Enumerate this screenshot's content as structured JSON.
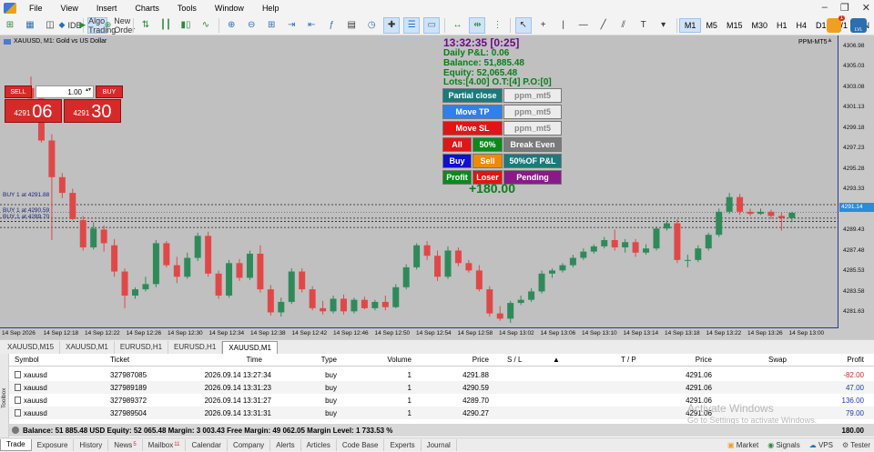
{
  "menu": {
    "items": [
      "File",
      "View",
      "Insert",
      "Charts",
      "Tools",
      "Window",
      "Help"
    ]
  },
  "toolbar": {
    "ide_label": "IDE",
    "algo_label": "Algo Trading",
    "new_order_label": "New Order",
    "timeframes": [
      "M1",
      "M5",
      "M15",
      "M30",
      "H1",
      "H4",
      "D1",
      "W1",
      "MN"
    ],
    "active_timeframe": "M1",
    "notification_count": "1",
    "news_badge": "LVL"
  },
  "chart": {
    "title": "XAUUSD, M1:  Gold vs US Dollar",
    "ea_name": "PPM-MT5",
    "current_price": "4291.14",
    "y_labels": [
      "4306.98",
      "4305.03",
      "4303.08",
      "4301.13",
      "4299.18",
      "4297.23",
      "4295.28",
      "4293.33",
      "4289.43",
      "4287.48",
      "4285.53",
      "4283.58",
      "4281.63"
    ],
    "x_labels": [
      "14 Sep 2026",
      "14 Sep 12:18",
      "14 Sep 12:22",
      "14 Sep 12:26",
      "14 Sep 12:30",
      "14 Sep 12:34",
      "14 Sep 12:38",
      "14 Sep 12:42",
      "14 Sep 12:46",
      "14 Sep 12:50",
      "14 Sep 12:54",
      "14 Sep 12:58",
      "14 Sep 13:02",
      "14 Sep 13:06",
      "14 Sep 13:10",
      "14 Sep 13:14",
      "14 Sep 13:18",
      "14 Sep 13:22",
      "14 Sep 13:26",
      "14 Sep 13:00"
    ],
    "order_labels": [
      "BUY 1 at 4291.88",
      "BUY 1 at 4290.59",
      "BUY 1 at 4289.70"
    ],
    "one_click": {
      "sell_label": "SELL",
      "buy_label": "BUY",
      "lot": "1.00",
      "sell_price_small": "4291",
      "sell_price_big": "06",
      "buy_price_small": "4291",
      "buy_price_big": "30"
    }
  },
  "panel": {
    "time": "13:32:35 [0:25]",
    "daily_pl": "Daily P&L: 0.06",
    "balance": "Balance: 51,885.48",
    "equity": "Equity: 52,065.48",
    "lots": "Lots:[4.00] O.T:[4] P.O:[0]",
    "buttons": {
      "partial_close": "Partial close",
      "partial_close_val": "ppm_mt5",
      "move_tp": "Move TP",
      "move_tp_val": "ppm_mt5",
      "move_sl": "Move SL",
      "move_sl_val": "ppm_mt5",
      "all": "All",
      "fifty": "50%",
      "break_even": "Break Even",
      "buy": "Buy",
      "sell": "Sell",
      "fifty_pl": "50%OF P&L",
      "profit": "Profit",
      "loser": "Loser",
      "pending": "Pending"
    },
    "total_profit": "+180.00",
    "colors": {
      "teal": "#1b7a7a",
      "blue": "#2f80ed",
      "red": "#e01515",
      "green": "#0a8a1a",
      "gray": "#7a7a7a",
      "purple": "#8a1a8a",
      "orange": "#f08a00",
      "navy": "#1010d0"
    }
  },
  "chart_tabs": [
    "XAUUSD,M15",
    "XAUUSD,M1",
    "EURUSD,H1",
    "EURUSD,H1",
    "XAUUSD,M1"
  ],
  "trade": {
    "headers": {
      "symbol": "Symbol",
      "ticket": "Ticket",
      "time": "Time",
      "type": "Type",
      "volume": "Volume",
      "price": "Price",
      "sl": "S / L",
      "tp": "T / P",
      "price2": "Price",
      "swap": "Swap",
      "profit": "Profit"
    },
    "rows": [
      {
        "symbol": "xauusd",
        "ticket": "327987085",
        "time": "2026.09.14 13:27:34",
        "type": "buy",
        "volume": "1",
        "price": "4291.88",
        "cur": "4291.06",
        "profit": "-82.00"
      },
      {
        "symbol": "xauusd",
        "ticket": "327989189",
        "time": "2026.09.14 13:31:23",
        "type": "buy",
        "volume": "1",
        "price": "4290.59",
        "cur": "4291.06",
        "profit": "47.00"
      },
      {
        "symbol": "xauusd",
        "ticket": "327989372",
        "time": "2026.09.14 13:31:27",
        "type": "buy",
        "volume": "1",
        "price": "4289.70",
        "cur": "4291.06",
        "profit": "136.00"
      },
      {
        "symbol": "xauusd",
        "ticket": "327989504",
        "time": "2026.09.14 13:31:31",
        "type": "buy",
        "volume": "1",
        "price": "4290.27",
        "cur": "4291.06",
        "profit": "79.00"
      }
    ],
    "balance_line": "Balance: 51 885.48 USD  Equity: 52 065.48  Margin: 3 003.43  Free Margin: 49 062.05  Margin Level: 1 733.53 %",
    "balance_profit": "180.00",
    "watermark_title": "Activate Windows",
    "watermark_sub": "Go to Settings to activate Windows.",
    "toolbox_label": "Toolbox"
  },
  "bottom_tabs": [
    {
      "label": "Trade",
      "badge": ""
    },
    {
      "label": "Exposure",
      "badge": ""
    },
    {
      "label": "History",
      "badge": ""
    },
    {
      "label": "News",
      "badge": "5"
    },
    {
      "label": "Mailbox",
      "badge": "11"
    },
    {
      "label": "Calendar",
      "badge": ""
    },
    {
      "label": "Company",
      "badge": ""
    },
    {
      "label": "Alerts",
      "badge": ""
    },
    {
      "label": "Articles",
      "badge": ""
    },
    {
      "label": "Code Base",
      "badge": ""
    },
    {
      "label": "Experts",
      "badge": ""
    },
    {
      "label": "Journal",
      "badge": ""
    }
  ],
  "status": {
    "market": "Market",
    "signals": "Signals",
    "vps": "VPS",
    "tester": "Tester"
  },
  "chart_data": {
    "type": "candlestick",
    "symbol": "XAUUSD",
    "timeframe": "M1",
    "y_range": [
      4280.6,
      4307.5
    ],
    "candles": [
      {
        "o": 4303.0,
        "h": 4304.1,
        "l": 4301.5,
        "c": 4302.0
      },
      {
        "o": 4302.0,
        "h": 4302.5,
        "l": 4297.8,
        "c": 4298.0
      },
      {
        "o": 4298.0,
        "h": 4298.6,
        "l": 4288.5,
        "c": 4294.5
      },
      {
        "o": 4294.5,
        "h": 4294.9,
        "l": 4292.5,
        "c": 4293.0
      },
      {
        "o": 4293.0,
        "h": 4293.4,
        "l": 4290.4,
        "c": 4290.5
      },
      {
        "o": 4290.4,
        "h": 4290.8,
        "l": 4287.5,
        "c": 4287.8
      },
      {
        "o": 4287.8,
        "h": 4290.2,
        "l": 4287.6,
        "c": 4289.6
      },
      {
        "o": 4289.5,
        "h": 4289.9,
        "l": 4287.4,
        "c": 4288.2
      },
      {
        "o": 4288.0,
        "h": 4288.6,
        "l": 4285.0,
        "c": 4285.5
      },
      {
        "o": 4285.5,
        "h": 4285.8,
        "l": 4282.0,
        "c": 4283.2
      },
      {
        "o": 4283.2,
        "h": 4284.0,
        "l": 4282.9,
        "c": 4283.8
      },
      {
        "o": 4283.8,
        "h": 4285.0,
        "l": 4283.6,
        "c": 4284.3
      },
      {
        "o": 4284.3,
        "h": 4288.5,
        "l": 4284.0,
        "c": 4288.2
      },
      {
        "o": 4288.2,
        "h": 4288.4,
        "l": 4285.9,
        "c": 4286.1
      },
      {
        "o": 4286.1,
        "h": 4286.9,
        "l": 4284.4,
        "c": 4285.0
      },
      {
        "o": 4285.0,
        "h": 4287.3,
        "l": 4284.8,
        "c": 4286.8
      },
      {
        "o": 4286.8,
        "h": 4289.2,
        "l": 4286.5,
        "c": 4288.9
      },
      {
        "o": 4288.9,
        "h": 4289.3,
        "l": 4285.0,
        "c": 4285.3
      },
      {
        "o": 4285.3,
        "h": 4285.6,
        "l": 4282.9,
        "c": 4283.2
      },
      {
        "o": 4283.2,
        "h": 4286.6,
        "l": 4283.0,
        "c": 4286.3
      },
      {
        "o": 4286.3,
        "h": 4286.7,
        "l": 4284.6,
        "c": 4284.9
      },
      {
        "o": 4284.9,
        "h": 4287.5,
        "l": 4284.7,
        "c": 4287.2
      },
      {
        "o": 4287.2,
        "h": 4288.0,
        "l": 4283.5,
        "c": 4283.8
      },
      {
        "o": 4283.8,
        "h": 4284.2,
        "l": 4281.3,
        "c": 4281.6
      },
      {
        "o": 4281.6,
        "h": 4283.0,
        "l": 4281.2,
        "c": 4282.6
      },
      {
        "o": 4282.6,
        "h": 4285.8,
        "l": 4282.4,
        "c": 4285.5
      },
      {
        "o": 4285.5,
        "h": 4285.8,
        "l": 4283.5,
        "c": 4283.8
      },
      {
        "o": 4283.8,
        "h": 4284.1,
        "l": 4281.8,
        "c": 4282.0
      },
      {
        "o": 4282.0,
        "h": 4282.7,
        "l": 4281.4,
        "c": 4281.7
      },
      {
        "o": 4281.7,
        "h": 4283.2,
        "l": 4281.5,
        "c": 4282.9
      },
      {
        "o": 4282.9,
        "h": 4283.3,
        "l": 4281.4,
        "c": 4281.7
      },
      {
        "o": 4281.7,
        "h": 4283.0,
        "l": 4281.5,
        "c": 4282.8
      },
      {
        "o": 4282.8,
        "h": 4283.1,
        "l": 4281.9,
        "c": 4282.0
      },
      {
        "o": 4282.0,
        "h": 4282.8,
        "l": 4281.8,
        "c": 4282.6
      },
      {
        "o": 4282.6,
        "h": 4283.2,
        "l": 4281.8,
        "c": 4282.1
      },
      {
        "o": 4282.1,
        "h": 4284.3,
        "l": 4282.0,
        "c": 4284.0
      },
      {
        "o": 4284.0,
        "h": 4286.2,
        "l": 4283.8,
        "c": 4285.9
      },
      {
        "o": 4285.9,
        "h": 4288.2,
        "l": 4285.7,
        "c": 4288.0
      },
      {
        "o": 4288.0,
        "h": 4288.4,
        "l": 4286.6,
        "c": 4287.0
      },
      {
        "o": 4287.0,
        "h": 4287.5,
        "l": 4284.6,
        "c": 4285.0
      },
      {
        "o": 4285.0,
        "h": 4287.9,
        "l": 4284.8,
        "c": 4287.5
      },
      {
        "o": 4287.5,
        "h": 4287.8,
        "l": 4286.0,
        "c": 4286.3
      },
      {
        "o": 4286.3,
        "h": 4286.6,
        "l": 4285.4,
        "c": 4285.6
      },
      {
        "o": 4285.6,
        "h": 4286.1,
        "l": 4283.6,
        "c": 4283.8
      },
      {
        "o": 4283.8,
        "h": 4284.1,
        "l": 4281.2,
        "c": 4281.5
      },
      {
        "o": 4281.5,
        "h": 4282.2,
        "l": 4280.8,
        "c": 4281.0
      },
      {
        "o": 4281.0,
        "h": 4282.7,
        "l": 4280.6,
        "c": 4282.5
      },
      {
        "o": 4282.5,
        "h": 4283.2,
        "l": 4282.3,
        "c": 4282.8
      },
      {
        "o": 4282.8,
        "h": 4283.9,
        "l": 4282.6,
        "c": 4283.6
      },
      {
        "o": 4283.6,
        "h": 4285.6,
        "l": 4283.4,
        "c": 4285.3
      },
      {
        "o": 4285.3,
        "h": 4285.8,
        "l": 4284.9,
        "c": 4285.6
      },
      {
        "o": 4285.6,
        "h": 4286.3,
        "l": 4285.4,
        "c": 4286.1
      },
      {
        "o": 4286.1,
        "h": 4287.1,
        "l": 4285.9,
        "c": 4286.8
      },
      {
        "o": 4286.8,
        "h": 4287.7,
        "l": 4286.6,
        "c": 4287.4
      },
      {
        "o": 4287.4,
        "h": 4288.1,
        "l": 4287.2,
        "c": 4287.9
      },
      {
        "o": 4287.9,
        "h": 4288.8,
        "l": 4287.7,
        "c": 4288.5
      },
      {
        "o": 4288.5,
        "h": 4289.5,
        "l": 4287.5,
        "c": 4287.8
      },
      {
        "o": 4287.8,
        "h": 4288.6,
        "l": 4287.3,
        "c": 4288.3
      },
      {
        "o": 4288.3,
        "h": 4288.6,
        "l": 4286.9,
        "c": 4287.3
      },
      {
        "o": 4287.3,
        "h": 4288.1,
        "l": 4287.1,
        "c": 4287.7
      },
      {
        "o": 4287.7,
        "h": 4289.8,
        "l": 4287.5,
        "c": 4289.6
      },
      {
        "o": 4289.6,
        "h": 4290.4,
        "l": 4289.4,
        "c": 4290.1
      },
      {
        "o": 4290.1,
        "h": 4290.5,
        "l": 4286.3,
        "c": 4286.6
      },
      {
        "o": 4286.6,
        "h": 4287.1,
        "l": 4285.9,
        "c": 4286.6
      },
      {
        "o": 4286.6,
        "h": 4288.0,
        "l": 4286.4,
        "c": 4287.7
      },
      {
        "o": 4287.7,
        "h": 4289.2,
        "l": 4287.5,
        "c": 4289.0
      },
      {
        "o": 4289.0,
        "h": 4291.5,
        "l": 4288.8,
        "c": 4291.2
      },
      {
        "o": 4291.2,
        "h": 4293.0,
        "l": 4291.0,
        "c": 4292.6
      },
      {
        "o": 4292.6,
        "h": 4292.9,
        "l": 4290.9,
        "c": 4291.2
      },
      {
        "o": 4291.2,
        "h": 4291.5,
        "l": 4290.8,
        "c": 4291.0
      },
      {
        "o": 4291.0,
        "h": 4291.5,
        "l": 4290.9,
        "c": 4291.2
      },
      {
        "o": 4291.2,
        "h": 4291.4,
        "l": 4290.5,
        "c": 4290.8
      },
      {
        "o": 4290.8,
        "h": 4291.1,
        "l": 4289.4,
        "c": 4290.6
      },
      {
        "o": 4290.6,
        "h": 4291.2,
        "l": 4290.2,
        "c": 4291.1
      }
    ]
  }
}
